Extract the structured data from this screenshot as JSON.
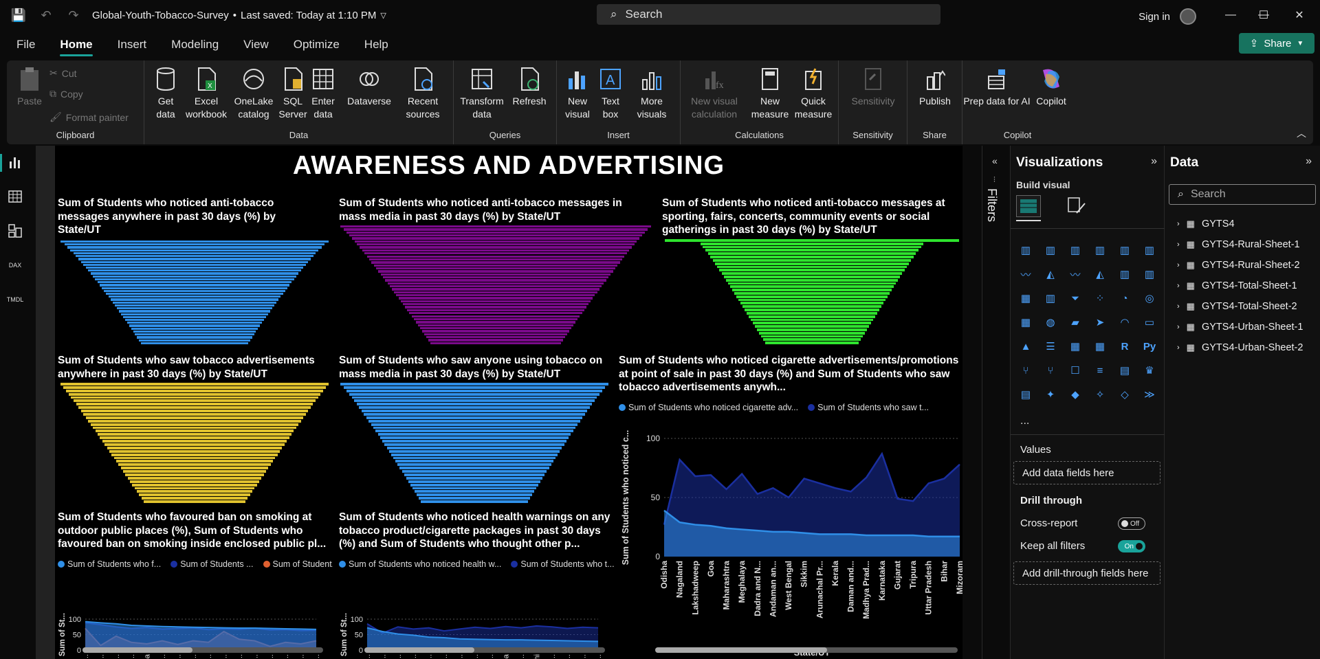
{
  "titlebar": {
    "document_title": "Global-Youth-Tobacco-Survey",
    "saved_status": "Last saved: Today at 1:10 PM",
    "search_placeholder": "Search",
    "sign_in": "Sign in"
  },
  "menu": {
    "items": [
      "File",
      "Home",
      "Insert",
      "Modeling",
      "View",
      "Optimize",
      "Help"
    ],
    "active": "Home",
    "share_label": "Share"
  },
  "ribbon": {
    "clipboard": {
      "paste": "Paste",
      "cut": "Cut",
      "copy": "Copy",
      "format_painter": "Format painter",
      "label": "Clipboard"
    },
    "data": {
      "get_data": "Get data",
      "excel": "Excel workbook",
      "onelake": "OneLake catalog",
      "sql": "SQL Server",
      "enter_data": "Enter data",
      "dataverse": "Dataverse",
      "recent": "Recent sources",
      "label": "Data"
    },
    "queries": {
      "transform": "Transform data",
      "refresh": "Refresh",
      "label": "Queries"
    },
    "insert": {
      "new_visual": "New visual",
      "text_box": "Text box",
      "more_visuals": "More visuals",
      "label": "Insert"
    },
    "calculations": {
      "new_visual_calc": "New visual calculation",
      "new_measure": "New measure",
      "quick_measure": "Quick measure",
      "label": "Calculations"
    },
    "sensitivity": {
      "btn": "Sensitivity",
      "label": "Sensitivity"
    },
    "share": {
      "publish": "Publish",
      "label": "Share"
    },
    "copilot": {
      "prep": "Prep data for AI",
      "copilot": "Copilot",
      "label": "Copilot"
    }
  },
  "report": {
    "title": "AWARENESS AND ADVERTISING",
    "visuals": [
      {
        "title": "Sum of Students who noticed anti-tobacco messages anywhere in past 30 days (%) by State/UT",
        "color": "#2f8fe8"
      },
      {
        "title": "Sum of Students who noticed anti-tobacco messages in mass media in past 30 days (%) by State/UT",
        "color": "#7a0a8a"
      },
      {
        "title": "Sum of Students who noticed anti-tobacco messages at sporting, fairs, concerts, community events or social gatherings in past 30 days (%) by State/UT",
        "color": "#2ee32e"
      },
      {
        "title": "Sum of Students who saw tobacco advertisements anywhere in past 30 days (%) by State/UT",
        "color": "#e0c22e"
      },
      {
        "title": "Sum of Students who saw anyone using tobacco on mass media in past 30 days (%) by State/UT",
        "color": "#2f8fe8"
      },
      {
        "title": "Sum of Students who noticed cigarette advertisements/promotions at point of sale in past 30 days (%) and Sum of Students who saw tobacco advertisements anywh..."
      },
      {
        "title": "Sum of Students who favoured ban on smoking at outdoor public places (%), Sum of Students who favoured ban on smoking inside enclosed public pl..."
      },
      {
        "title": "Sum of Students who noticed health warnings on any tobacco product/cigarette packages in past 30 days (%) and Sum of Students who thought other p..."
      }
    ],
    "legend_big": [
      "Sum of Students who noticed cigarette adv...",
      "Sum of Students who saw t..."
    ],
    "legend_small1": [
      "Sum of Students who f...",
      "Sum of Students ...",
      "Sum of Student..."
    ],
    "legend_small2": [
      "Sum of Students who noticed health w...",
      "Sum of Students who t..."
    ],
    "big_ylabel": "Sum of Students who noticed c...",
    "big_xlabel": "State/UT",
    "small_ylabel": "Sum of St...",
    "yticks_big": [
      "100",
      "50",
      "0"
    ],
    "yticks_small": [
      "100",
      "50",
      "0"
    ],
    "xticks_small1": [
      "Miz...",
      "Ker...",
      "Ma...",
      "Ma...",
      "Goa",
      "Raja...",
      "Pun...",
      "Chh...",
      "Lak...",
      "Aru...",
      "Sikk...",
      "Chh...",
      "Kar...",
      "Har...",
      "Tela...",
      "Da..."
    ],
    "xticks_small2": [
      "Miz...",
      "Aru...",
      "Nag...",
      "Me...",
      "Raja...",
      "Sikk...",
      "Guj...",
      "Utta...",
      "Lak...",
      "Goa",
      "Ch...",
      "Delhi",
      "Ma...",
      "And...",
      "Wes...",
      "Ass..."
    ]
  },
  "chart_data": [
    {
      "type": "area",
      "title": "Sum of Students who noticed cigarette advertisements/promotions at point of sale in past 30 days (%) and Sum of Students who saw tobacco advertisements anywh...",
      "xlabel": "State/UT",
      "ylabel": "Sum of Students who noticed c...",
      "ylim": [
        0,
        100
      ],
      "categories": [
        "Odisha",
        "Nagaland",
        "Lakshadweep",
        "Goa",
        "Maharashtra",
        "Meghalaya",
        "Dadra and N...",
        "Andaman an...",
        "West Bengal",
        "Sikkim",
        "Arunachal Pr...",
        "Kerala",
        "Daman and...",
        "Madhya Prad...",
        "Karnataka",
        "Gujarat",
        "Tripura",
        "Uttar Pradesh",
        "Bihar",
        "Mizoram"
      ],
      "series": [
        {
          "name": "Sum of Students who noticed cigarette adv...",
          "color": "#2f8fe8",
          "values": [
            39,
            29,
            27,
            26,
            24,
            23,
            22,
            21,
            21,
            20,
            19,
            19,
            19,
            18,
            18,
            18,
            18,
            17,
            17,
            17
          ]
        },
        {
          "name": "Sum of Students who saw t...",
          "color": "#1a2fa0",
          "values": [
            27,
            82,
            68,
            69,
            57,
            70,
            53,
            58,
            50,
            66,
            62,
            58,
            55,
            67,
            87,
            49,
            47,
            62,
            66,
            78
          ]
        }
      ]
    },
    {
      "type": "area",
      "title": "Sum of Students who favoured ban on smoking at outdoor public places (%), Sum of Students who favoured ban on smoking inside enclosed public pl...",
      "ylim": [
        0,
        100
      ],
      "categories": [
        "Miz...",
        "Ker...",
        "Ma...",
        "Ma...",
        "Goa",
        "Raja...",
        "Pun...",
        "Chh...",
        "Lak...",
        "Aru...",
        "Sikk...",
        "Chh...",
        "Kar...",
        "Har...",
        "Tela...",
        "Da..."
      ],
      "series": [
        {
          "name": "Sum of Students who f...",
          "color": "#2f8fe8",
          "values": [
            92,
            88,
            85,
            80,
            78,
            76,
            75,
            74,
            73,
            72,
            71,
            71,
            70,
            69,
            68,
            67
          ]
        },
        {
          "name": "Sum of Students ...",
          "color": "#1a2fa0",
          "values": [
            88,
            82,
            75,
            70,
            73,
            68,
            70,
            72,
            66,
            69,
            67,
            71,
            65,
            66,
            63,
            64
          ]
        },
        {
          "name": "Sum of Student...",
          "color": "#e06030",
          "values": [
            70,
            15,
            45,
            25,
            20,
            30,
            18,
            30,
            25,
            60,
            35,
            30,
            12,
            25,
            20,
            30
          ]
        }
      ]
    },
    {
      "type": "area",
      "title": "Sum of Students who noticed health warnings on any tobacco product/cigarette packages in past 30 days (%) and Sum of Students who thought other p...",
      "ylim": [
        0,
        100
      ],
      "categories": [
        "Miz...",
        "Aru...",
        "Nag...",
        "Me...",
        "Raja...",
        "Sikk...",
        "Guj...",
        "Utta...",
        "Lak...",
        "Goa",
        "Ch...",
        "Delhi",
        "Ma...",
        "And...",
        "Wes...",
        "Ass..."
      ],
      "series": [
        {
          "name": "Sum of Students who noticed health w...",
          "color": "#2f8fe8",
          "values": [
            72,
            60,
            52,
            48,
            42,
            40,
            36,
            35,
            34,
            33,
            33,
            32,
            31,
            30,
            29,
            28
          ]
        },
        {
          "name": "Sum of Students who t...",
          "color": "#1a2fa0",
          "values": [
            85,
            55,
            75,
            68,
            72,
            62,
            68,
            74,
            70,
            76,
            72,
            78,
            75,
            70,
            74,
            72
          ]
        }
      ]
    }
  ],
  "filters": {
    "label": "Filters"
  },
  "visualizations": {
    "title": "Visualizations",
    "build_visual": "Build visual",
    "values_label": "Values",
    "add_data": "Add data fields here",
    "drill_through": "Drill through",
    "cross_report": "Cross-report",
    "cross_report_state": "Off",
    "keep_filters": "Keep all filters",
    "keep_filters_state": "On",
    "add_drill": "Add drill-through fields here"
  },
  "data_pane": {
    "title": "Data",
    "search_placeholder": "Search",
    "tables": [
      "GYTS4",
      "GYTS4-Rural-Sheet-1",
      "GYTS4-Rural-Sheet-2",
      "GYTS4-Total-Sheet-1",
      "GYTS4-Total-Sheet-2",
      "GYTS4-Urban-Sheet-1",
      "GYTS4-Urban-Sheet-2"
    ]
  }
}
